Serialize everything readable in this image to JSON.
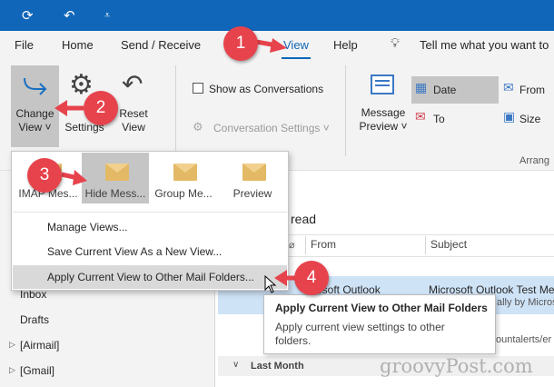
{
  "titlebar": {
    "refresh_icon": "sync-icon",
    "undo_icon": "undo-icon",
    "qat_icon": "customize-icon"
  },
  "menu": {
    "file": "File",
    "home": "Home",
    "send_receive": "Send / Receive",
    "view": "View",
    "help": "Help",
    "tell_me": "Tell me what you want to"
  },
  "ribbon": {
    "change_view_line1": "Change",
    "change_view_line2": "View ˅",
    "settings": "Settings",
    "reset_line1": "Reset",
    "reset_line2": "View",
    "show_as_conversations": "Show as Conversations",
    "conversation_settings": "Conversation Settings ˅",
    "message_preview_line1": "Message",
    "message_preview_line2": "Preview ˅",
    "date": "Date",
    "from": "From",
    "to": "To",
    "size": "Size",
    "arrange": "Arrang"
  },
  "dropdown": {
    "tiles": [
      {
        "label": "IMAP Mes..."
      },
      {
        "label": "Hide Mess..."
      },
      {
        "label": "Group Me..."
      },
      {
        "label": "Preview"
      }
    ],
    "manage_views": "Manage Views...",
    "save_view": "Save Current View As a New View...",
    "apply_view": "Apply Current View to Other Mail Folders..."
  },
  "folders": {
    "inbox": "Inbox",
    "drafts": "Drafts",
    "airmail": "[Airmail]",
    "gmail": "[Gmail]"
  },
  "maillist": {
    "unread_tab": "read",
    "col_from": "From",
    "col_subject": "Subject",
    "row_from": "rosoft Outlook",
    "row_subject": "Microsoft Outlook Test Me",
    "row_subject2": "ally by Micros",
    "row_subject3": "ountalerts/er",
    "group_header": "Last Month"
  },
  "tooltip": {
    "title": "Apply Current View to Other Mail Folders",
    "body_line1": "Apply current view settings to other",
    "body_line2": "folders."
  },
  "badges": [
    "1",
    "2",
    "3",
    "4"
  ],
  "watermark": "groovyPost.com",
  "colors": {
    "titlebar": "#1066b8",
    "badge": "#e7434d",
    "selected": "#c5c5c5"
  }
}
